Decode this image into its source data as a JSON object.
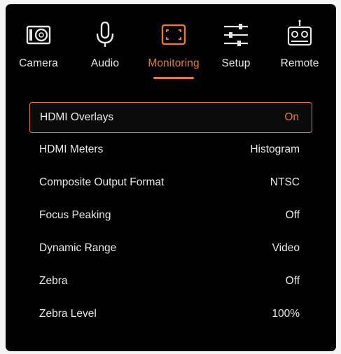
{
  "tabs": [
    {
      "id": "camera",
      "label": "Camera",
      "icon": "camera-icon"
    },
    {
      "id": "audio",
      "label": "Audio",
      "icon": "microphone-icon"
    },
    {
      "id": "monitoring",
      "label": "Monitoring",
      "icon": "monitor-frame-icon",
      "active": true
    },
    {
      "id": "setup",
      "label": "Setup",
      "icon": "sliders-icon"
    },
    {
      "id": "remote",
      "label": "Remote",
      "icon": "remote-control-icon"
    }
  ],
  "settings": [
    {
      "name": "HDMI Overlays",
      "value": "On",
      "selected": true
    },
    {
      "name": "HDMI Meters",
      "value": "Histogram"
    },
    {
      "name": "Composite Output Format",
      "value": "NTSC"
    },
    {
      "name": "Focus Peaking",
      "value": "Off"
    },
    {
      "name": "Dynamic Range",
      "value": "Video"
    },
    {
      "name": "Zebra",
      "value": "Off"
    },
    {
      "name": "Zebra Level",
      "value": "100%"
    }
  ],
  "colors": {
    "accent": "#e8792a",
    "background": "#000000",
    "text": "#e9e9e9"
  }
}
